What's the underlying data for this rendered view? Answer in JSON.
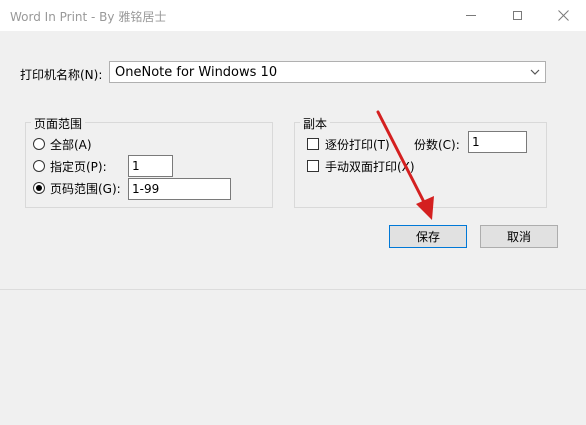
{
  "window": {
    "title": "Word In Print - By 雅铭居士"
  },
  "printer": {
    "label": "打印机名称(N):",
    "value": "OneNote for Windows 10"
  },
  "page_range": {
    "group_title": "页面范围",
    "options": [
      {
        "label": "全部(A)",
        "selected": false
      },
      {
        "label": "指定页(P):",
        "selected": false,
        "value": "1"
      },
      {
        "label": "页码范围(G):",
        "selected": true,
        "value": "1-99"
      }
    ]
  },
  "copies": {
    "group_title": "副本",
    "collate_label": "逐份打印(T)",
    "collate_checked": false,
    "duplex_label": "手动双面打印(X)",
    "duplex_checked": false,
    "count_label": "份数(C):",
    "count_value": "1"
  },
  "buttons": {
    "save": "保存",
    "cancel": "取消"
  },
  "colors": {
    "title_text": "#999999",
    "annotation_arrow": "#d42020",
    "default_button_border": "#0078d7"
  },
  "icons": [
    "minimize-icon",
    "maximize-icon",
    "close-icon",
    "chevron-down-icon",
    "red-arrow-annotation"
  ]
}
